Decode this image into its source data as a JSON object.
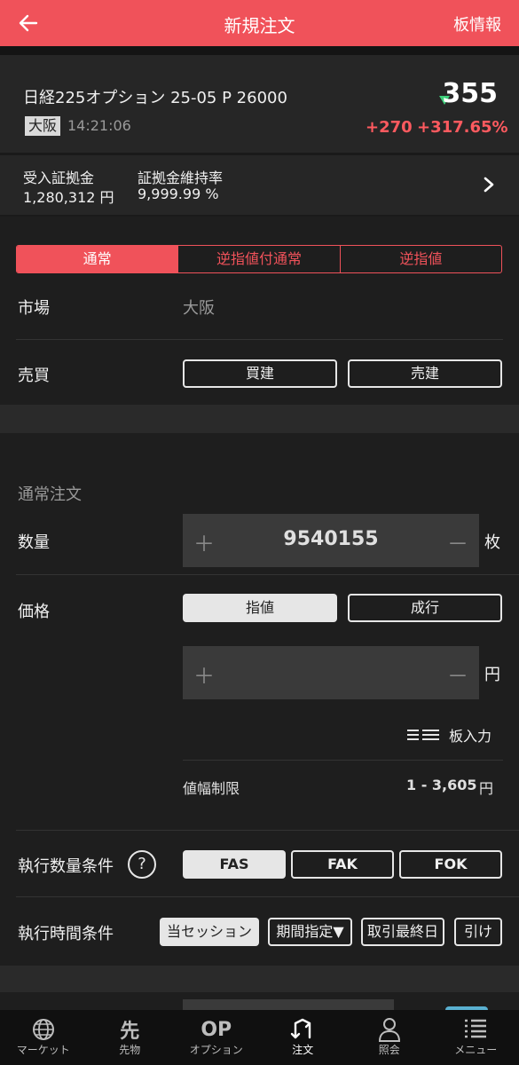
{
  "header": {
    "title": "新規注文",
    "right_link": "板情報",
    "back_icon": "arrow-left-icon"
  },
  "instrument": {
    "name": "日経225オプション 25-05 P 26000",
    "exchange": "大阪",
    "time": "14:21:06",
    "price": "355",
    "change": "+270",
    "change_pct": "+317.65%",
    "up_color": "#ff5a5f",
    "tick_color": "#3ecf7a"
  },
  "margin": {
    "received_label": "受入証拠金",
    "received_value": "1,280,312 円",
    "ratio_label": "証拠金維持率",
    "ratio_value": "9,999.99 %"
  },
  "order_type_tabs": [
    "通常",
    "逆指値付通常",
    "逆指値"
  ],
  "market": {
    "label": "市場",
    "value": "大阪"
  },
  "trade": {
    "label": "売買",
    "buy": "買建",
    "sell": "売建"
  },
  "normal_order": {
    "section_title": "通常注文",
    "quantity_label": "数量",
    "quantity_value": "9540155",
    "quantity_unit": "枚",
    "price_label": "価格",
    "limit": "指値",
    "market_order": "成行",
    "price_value": "",
    "price_unit": "円",
    "board_input": "板入力",
    "price_limit_label": "値幅制限",
    "price_limit_value": "1 - 3,605",
    "price_limit_unit": "円"
  },
  "exec_qty": {
    "label": "執行数量条件",
    "options": [
      "FAS",
      "FAK",
      "FOK"
    ]
  },
  "exec_time": {
    "label": "執行時間条件",
    "options": [
      "当セッション",
      "期間指定▼",
      "取引最終日",
      "引け"
    ]
  },
  "accent_color": "#f0525a",
  "tabbar": [
    {
      "label": "マーケット",
      "icon": "globe-icon",
      "glyph": ""
    },
    {
      "label": "先物",
      "icon": "futures-icon",
      "glyph": "先"
    },
    {
      "label": "オプション",
      "icon": "option-icon",
      "glyph": "OP"
    },
    {
      "label": "注文",
      "icon": "order-icon",
      "glyph": ""
    },
    {
      "label": "照会",
      "icon": "person-icon",
      "glyph": ""
    },
    {
      "label": "メニュー",
      "icon": "menu-icon",
      "glyph": ""
    }
  ]
}
